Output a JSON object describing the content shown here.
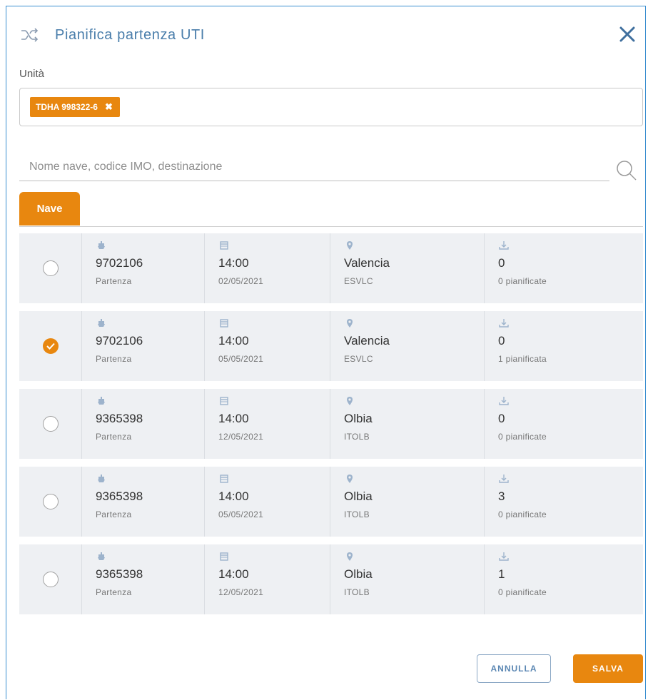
{
  "dialog": {
    "title": "Pianifica partenza UTI",
    "icon": "shuffle-icon",
    "close_icon": "close-icon"
  },
  "unit_field": {
    "label": "Unità",
    "chips": [
      {
        "label": "TDHA 998322-6"
      }
    ]
  },
  "search": {
    "placeholder": "Nome nave, codice IMO, destinazione",
    "value": ""
  },
  "tabs": [
    {
      "label": "Nave",
      "active": true
    }
  ],
  "rows": [
    {
      "selected": false,
      "imo": "9702106",
      "imo_sub": "Partenza",
      "time": "14:00",
      "date": "02/05/2021",
      "city": "Valencia",
      "code": "ESVLC",
      "count": "0",
      "planned": "0 pianificate"
    },
    {
      "selected": true,
      "imo": "9702106",
      "imo_sub": "Partenza",
      "time": "14:00",
      "date": "05/05/2021",
      "city": "Valencia",
      "code": "ESVLC",
      "count": "0",
      "planned": "1 pianificata"
    },
    {
      "selected": false,
      "imo": "9365398",
      "imo_sub": "Partenza",
      "time": "14:00",
      "date": "12/05/2021",
      "city": "Olbia",
      "code": "ITOLB",
      "count": "0",
      "planned": "0 pianificate"
    },
    {
      "selected": false,
      "imo": "9365398",
      "imo_sub": "Partenza",
      "time": "14:00",
      "date": "05/05/2021",
      "city": "Olbia",
      "code": "ITOLB",
      "count": "3",
      "planned": "0 pianificate"
    },
    {
      "selected": false,
      "imo": "9365398",
      "imo_sub": "Partenza",
      "time": "14:00",
      "date": "12/05/2021",
      "city": "Olbia",
      "code": "ITOLB",
      "count": "1",
      "planned": "0 pianificate"
    }
  ],
  "buttons": {
    "cancel": "ANNULLA",
    "save": "SALVA"
  },
  "colors": {
    "accent": "#e8870f",
    "title": "#4a7eab",
    "row_bg": "#eef0f3",
    "border": "#3a8fd0"
  }
}
